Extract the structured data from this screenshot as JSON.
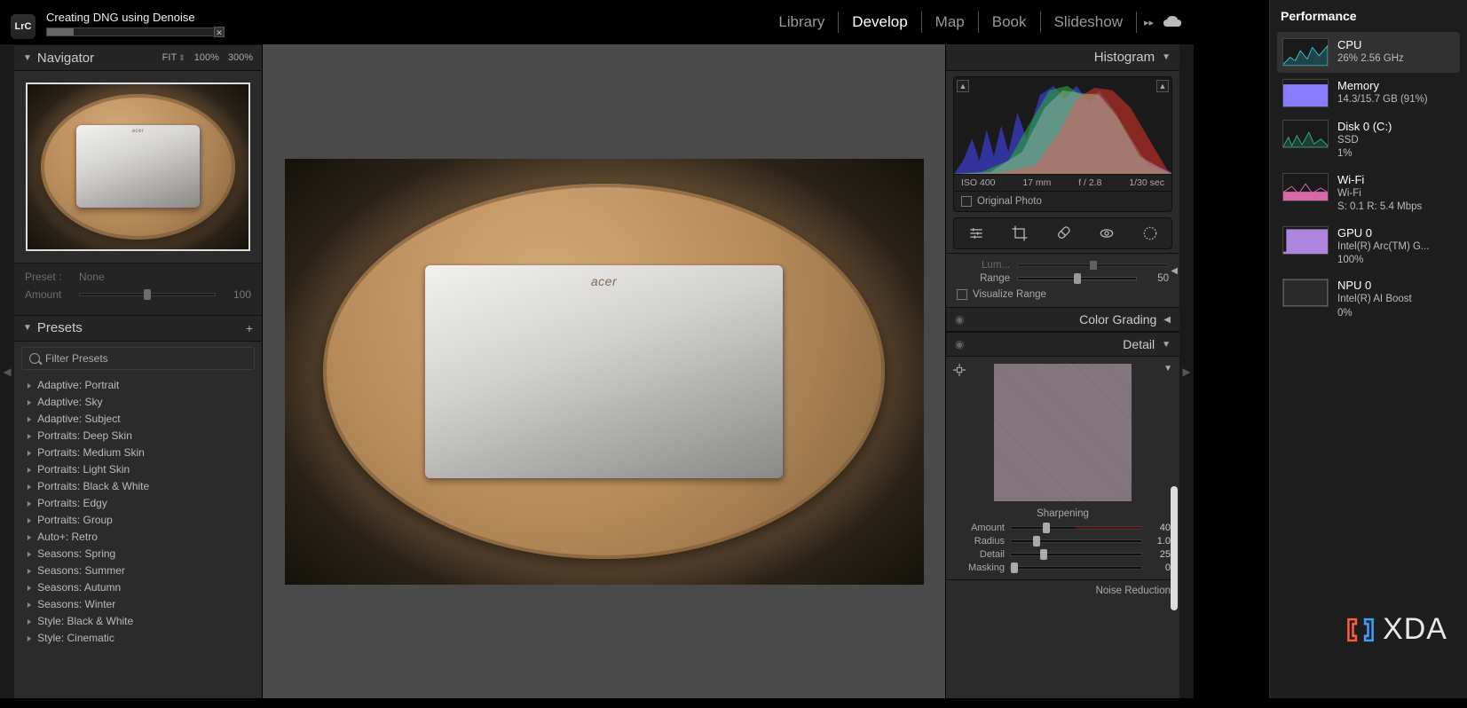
{
  "app": {
    "logo": "LrC",
    "titlebar": "Creating DNG using Denoise"
  },
  "modules": {
    "library": "Library",
    "develop": "Develop",
    "map": "Map",
    "book": "Book",
    "slideshow": "Slideshow"
  },
  "navigator": {
    "title": "Navigator",
    "zoom": {
      "fit": "FIT",
      "p100": "100%",
      "p300": "300%"
    }
  },
  "preset_amount": {
    "preset_label": "Preset :",
    "preset_value": "None",
    "amount_label": "Amount",
    "amount_value": "100"
  },
  "presets": {
    "title": "Presets",
    "filter_placeholder": "Filter Presets",
    "items": [
      "Adaptive: Portrait",
      "Adaptive: Sky",
      "Adaptive: Subject",
      "Portraits: Deep Skin",
      "Portraits: Medium Skin",
      "Portraits: Light Skin",
      "Portraits: Black & White",
      "Portraits: Edgy",
      "Portraits: Group",
      "Auto+: Retro",
      "Seasons: Spring",
      "Seasons: Summer",
      "Seasons: Autumn",
      "Seasons: Winter",
      "Style: Black & White",
      "Style: Cinematic"
    ]
  },
  "histogram": {
    "title": "Histogram",
    "meta": {
      "iso": "ISO 400",
      "focal": "17 mm",
      "aperture": "f / 2.8",
      "shutter": "1/30 sec"
    },
    "original_label": "Original Photo"
  },
  "range_panel": {
    "truncated_label": "Lum...",
    "range_label": "Range",
    "range_value": "50",
    "visualize_label": "Visualize Range"
  },
  "color_grading": {
    "title": "Color Grading"
  },
  "detail": {
    "title": "Detail",
    "sharpening_hdr": "Sharpening",
    "amount": {
      "label": "Amount",
      "value": "40"
    },
    "radius": {
      "label": "Radius",
      "value": "1.0"
    },
    "detail": {
      "label": "Detail",
      "value": "25"
    },
    "masking": {
      "label": "Masking",
      "value": "0"
    },
    "noise_reduction_hdr": "Noise Reduction"
  },
  "photo": {
    "brand_on_laptop": "acer"
  },
  "task_manager": {
    "title": "Performance",
    "items": [
      {
        "key": "cpu",
        "name": "CPU",
        "sub1": "26%  2.56 GHz",
        "sub2": ""
      },
      {
        "key": "memory",
        "name": "Memory",
        "sub1": "14.3/15.7 GB (91%)",
        "sub2": ""
      },
      {
        "key": "disk",
        "name": "Disk 0 (C:)",
        "sub1": "SSD",
        "sub2": "1%"
      },
      {
        "key": "wifi",
        "name": "Wi-Fi",
        "sub1": "Wi-Fi",
        "sub2": "S: 0.1 R: 5.4 Mbps"
      },
      {
        "key": "gpu",
        "name": "GPU 0",
        "sub1": "Intel(R) Arc(TM) G...",
        "sub2": "100%"
      },
      {
        "key": "npu",
        "name": "NPU 0",
        "sub1": "Intel(R) AI Boost",
        "sub2": "0%"
      }
    ]
  },
  "watermark": {
    "text": "XDA"
  }
}
